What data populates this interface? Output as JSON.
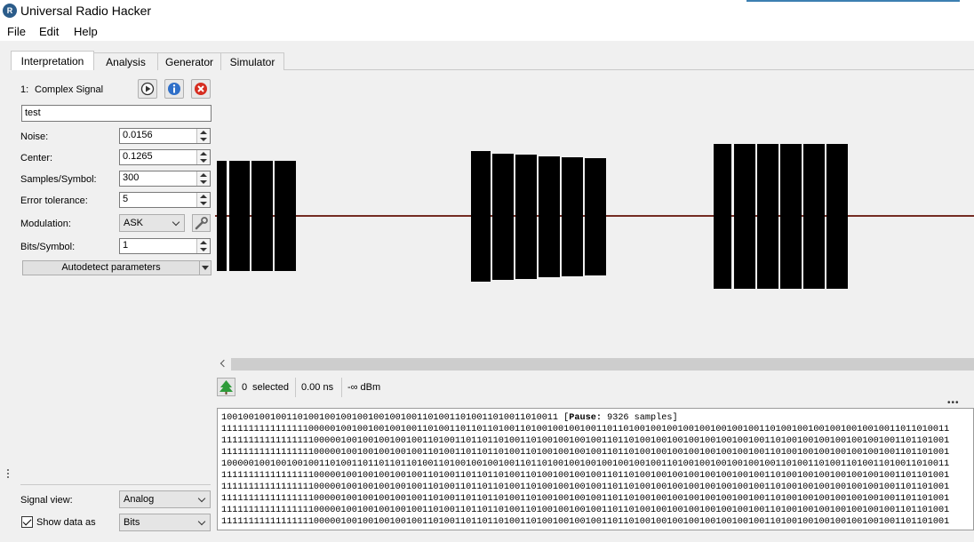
{
  "window": {
    "title": "Universal Radio Hacker"
  },
  "menu": [
    "File",
    "Edit",
    "Help"
  ],
  "tabs": [
    "Interpretation",
    "Analysis",
    "Generator",
    "Simulator"
  ],
  "signal": {
    "index": "1:",
    "name": "Complex Signal",
    "name_input": "test",
    "params": [
      {
        "label": "Noise:",
        "value": "0.0156"
      },
      {
        "label": "Center:",
        "value": "0.1265"
      },
      {
        "label": "Samples/Symbol:",
        "value": "300"
      },
      {
        "label": "Error tolerance:",
        "value": "5"
      }
    ],
    "modulation": {
      "label": "Modulation:",
      "value": "ASK"
    },
    "bits_per_symbol": {
      "label": "Bits/Symbol:",
      "value": "1"
    },
    "autodetect_label": "Autodetect parameters",
    "signal_view": {
      "label": "Signal view:",
      "value": "Analog"
    },
    "show_data_as": {
      "label": "Show data as",
      "value": "Bits",
      "checked": true
    }
  },
  "status": {
    "selected": "0",
    "selected_label": "selected",
    "time": "0.00 ns",
    "power": "-∞ dBm"
  },
  "protocol": {
    "first_line_bits": "10010010010011010010010010010010010011010011010011010011010011",
    "pause_label": "Pause:",
    "pause_value": "9326 samples",
    "lines": [
      "11111111111111110000010010010010010011010011011011010011010010010010011011010010010010010010010010011010010010010010010010011011010011",
      "11111111111111111000001001001001001001101001101101101001101001001001001101101001001001001001001001001101001001001001001001001101101001",
      "11111111111111111000001001001001001001101001101101101001101001001001001101101001001001001001001001001101001001001001001001001101101001",
      "10000010010010010011010011011011011010011010010010010011011010010010010010010010011010010010010010010011010011010011010011010011010011",
      "11111111111111111000001001001001001001101001101101101001101001001001001101101001001001001001001001001101001001001001001001001101101001",
      "11111111111111111000001001001001001001101001101101101001101001001001001101101001001001001001001001001101001001001001001001001101101001",
      "11111111111111111000001001001001001001101001101101101001101001001001001101101001001001001001001001001101001001001001001001001101101001",
      "11111111111111111000001001001001001001101001101101101001101001001001001101101001001001001001001001001101001001001001001001001101101001",
      "11111111111111111000001001001001001001101001101101101001101001001001001101101001001001001001001001001101001001001001001001001101101001"
    ]
  },
  "colors": {
    "signal": "#000000",
    "noise_line": "#8b2a1e",
    "accent": "#3c7fb1"
  }
}
